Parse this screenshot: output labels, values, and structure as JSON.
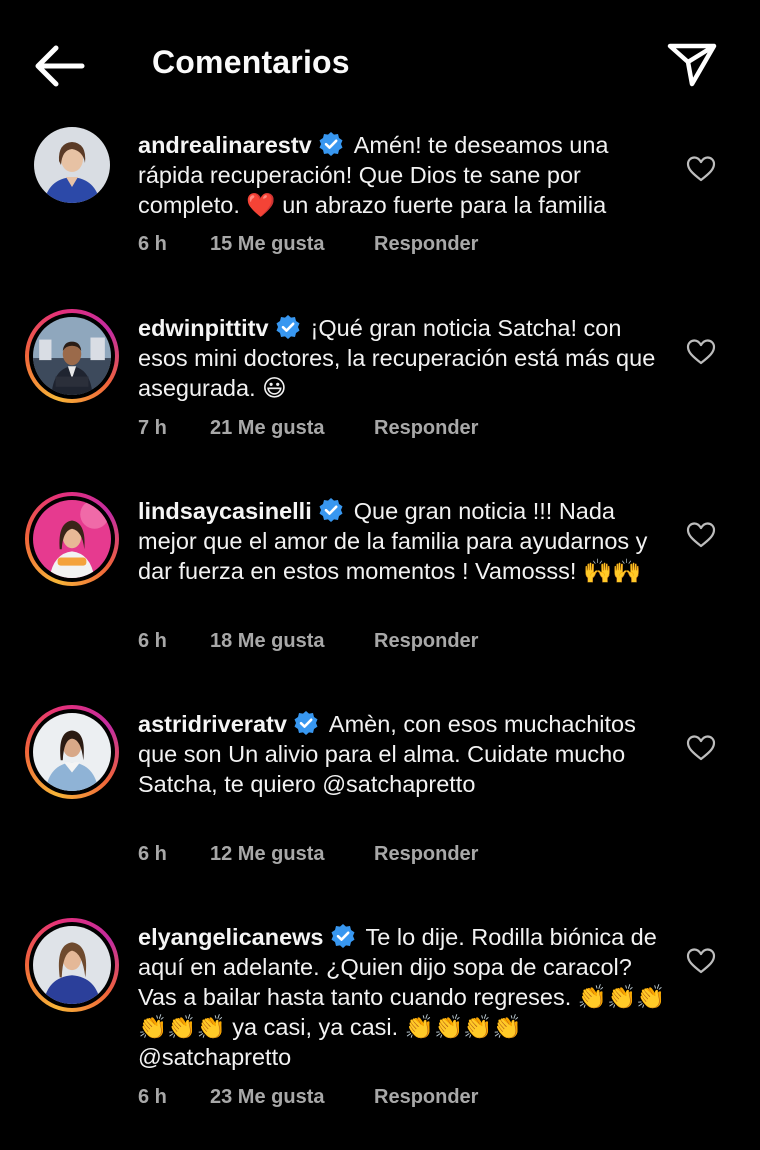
{
  "header": {
    "title": "Comentarios",
    "back_icon": "arrow-left-icon",
    "share_icon": "paper-plane-icon"
  },
  "colors": {
    "background": "#000000",
    "text": "#f2f2f2",
    "meta": "#a8a8a8",
    "verified": "#3897f0",
    "story_ring": [
      "#f7b538",
      "#f0643a",
      "#e5307a",
      "#c32ca0"
    ]
  },
  "comments": [
    {
      "username": "andrealinarestv",
      "verified": true,
      "story_ring": false,
      "text_parts": [
        "Amén! te deseamos una rápida recuperación! Que Dios te sane por completo. ",
        "❤️",
        " un abrazo fuerte para la familia"
      ],
      "time": "6 h",
      "likes": "15 Me gusta",
      "reply": "Responder"
    },
    {
      "username": "edwinpittitv",
      "verified": true,
      "story_ring": true,
      "text_parts": [
        "¡Qué gran noticia Satcha! con esos mini doctores, la recuperación está más que asegurada. 😃"
      ],
      "time": "7 h",
      "likes": "21 Me gusta",
      "reply": "Responder"
    },
    {
      "username": "lindsaycasinelli",
      "verified": true,
      "story_ring": true,
      "text_parts": [
        "Que gran noticia !!! Nada mejor que el amor de la familia para ayudarnos y dar fuerza en estos momentos ! Vamosss! 🙌🙌"
      ],
      "time": "6 h",
      "likes": "18 Me gusta",
      "reply": "Responder"
    },
    {
      "username": "astridriveratv",
      "verified": true,
      "story_ring": true,
      "text_parts": [
        "Amèn, con esos muchachitos que son Un alivio para el alma. Cuidate mucho Satcha, te quiero @satchapretto"
      ],
      "time": "6 h",
      "likes": "12 Me gusta",
      "reply": "Responder"
    },
    {
      "username": "elyangelicanews",
      "verified": true,
      "story_ring": true,
      "text_parts": [
        "Te lo dije. Rodilla biónica de aquí en adelante. ¿Quien dijo sopa de caracol? Vas a bailar hasta tanto cuando regreses. 👏👏👏👏👏👏 ya casi, ya casi. 👏👏👏👏 @satchapretto"
      ],
      "time": "6 h",
      "likes": "23 Me gusta",
      "reply": "Responder"
    }
  ],
  "icons": {
    "verified": "verified-badge-icon",
    "like": "heart-outline-icon"
  }
}
